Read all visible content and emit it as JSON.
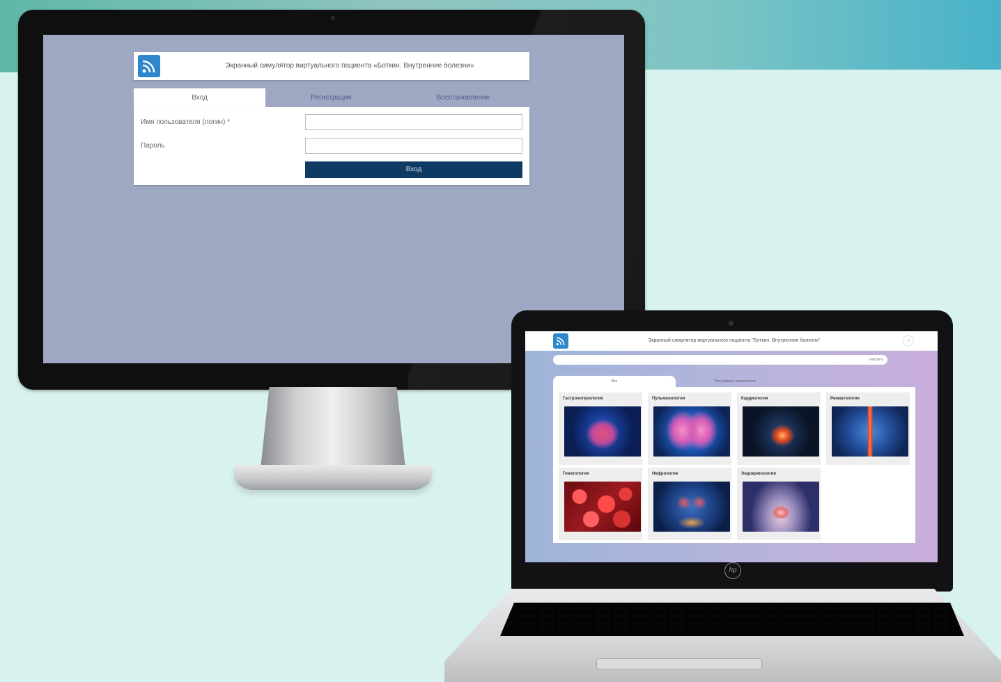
{
  "desktop": {
    "header": {
      "title": "Экранный симулятор виртуального пациента «Боткин. Внутренние болезни»"
    },
    "tabs": [
      {
        "label": "Вход",
        "active": true
      },
      {
        "label": "Регистрация",
        "active": false
      },
      {
        "label": "Восстановление",
        "active": false
      }
    ],
    "form": {
      "username_label": "Имя пользователя (логин) *",
      "username_value": "",
      "password_label": "Пароль",
      "password_value": "",
      "submit_label": "Вход"
    }
  },
  "laptop": {
    "header": {
      "title": "Экранный симулятор виртуального пациента \"Боткин. Внутренние болезни\""
    },
    "search": {
      "button_label": "очистить"
    },
    "tabs": [
      {
        "label": "Все",
        "active": true
      },
      {
        "label": "Популярные клинические",
        "active": false
      }
    ],
    "cards": [
      {
        "title": "Гастроэнтерология",
        "image": "digestive-system-image"
      },
      {
        "title": "Пульмонология",
        "image": "lungs-image"
      },
      {
        "title": "Кардиология",
        "image": "heart-image"
      },
      {
        "title": "Ревматология",
        "image": "spine-image"
      },
      {
        "title": "Гематология",
        "image": "blood-cells-image"
      },
      {
        "title": "Нефрология",
        "image": "kidneys-image"
      },
      {
        "title": "Эндокринология",
        "image": "thyroid-image"
      }
    ],
    "brand_logo": "hp"
  },
  "colors": {
    "background": "#d8f2ef",
    "accent_button": "#0f3a63",
    "logo_blue": "#2f86cb",
    "monitor_screen_bg": "#9ea8c2"
  }
}
